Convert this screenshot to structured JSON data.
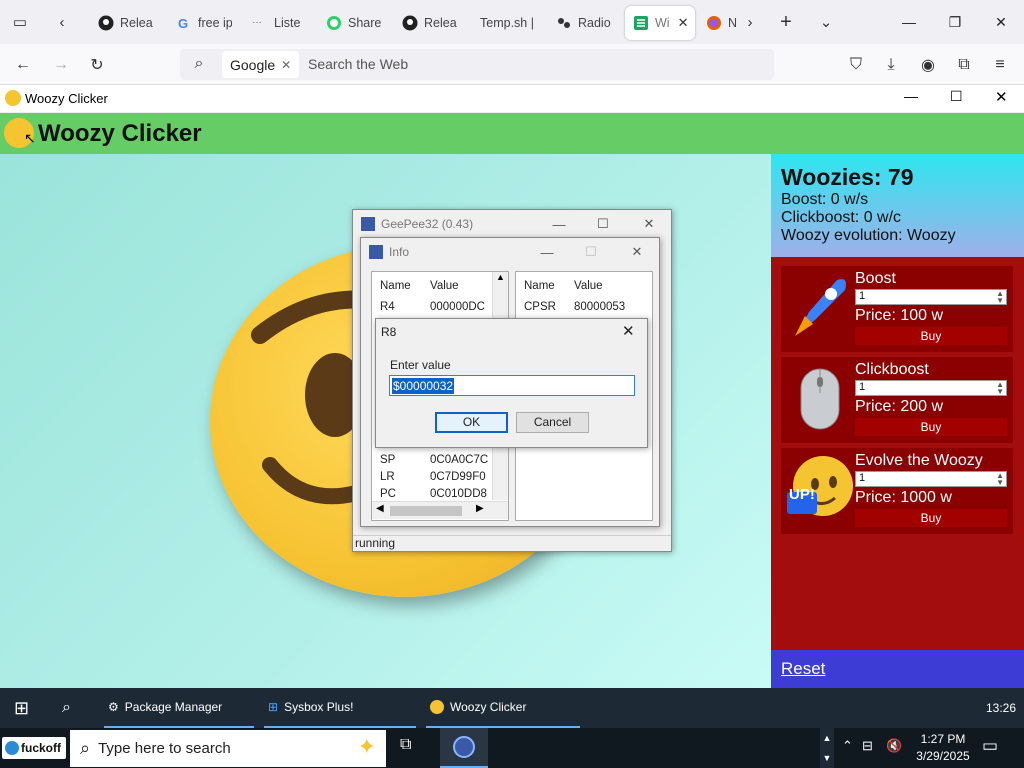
{
  "browser": {
    "tabs": [
      {
        "label": "Relea",
        "icon": "github-icon"
      },
      {
        "label": "free ip",
        "icon": "google-icon"
      },
      {
        "label": "Liste",
        "icon": "dots-icon"
      },
      {
        "label": "Share",
        "icon": "whatsapp-icon"
      },
      {
        "label": "Relea",
        "icon": "github-icon"
      },
      {
        "label": "Temp.sh |",
        "icon": "none"
      },
      {
        "label": "Radio",
        "icon": "radio-icon"
      },
      {
        "label": "Wi",
        "icon": "sheet-icon"
      },
      {
        "label": "N",
        "icon": "firefox-icon"
      }
    ],
    "search_engine_chip": "Google",
    "url_placeholder": "Search the Web"
  },
  "app": {
    "window_title": "Woozy Clicker",
    "header_title": "Woozy Clicker",
    "stats": {
      "woozies": "Woozies: 79",
      "boost": "Boost: 0 w/s",
      "clickboost": "Clickboost: 0 w/c",
      "evolution": "Woozy evolution: Woozy"
    },
    "shop": [
      {
        "title": "Boost",
        "qty": "1",
        "price": "Price: 100 w",
        "buy": "Buy",
        "icon": "rocket-icon"
      },
      {
        "title": "Clickboost",
        "qty": "1",
        "price": "Price: 200 w",
        "buy": "Buy",
        "icon": "mouse-icon"
      },
      {
        "title": "Evolve the Woozy",
        "qty": "1",
        "price": "Price: 1000 w",
        "buy": "Buy",
        "icon": "woozy-up-icon",
        "badge": "UP!"
      }
    ],
    "reset": "Reset"
  },
  "emulator": {
    "title": "GeePee32 (0.43)",
    "status": "running",
    "info_title": "Info",
    "col_name": "Name",
    "col_value": "Value",
    "left_regs": [
      {
        "name": "R4",
        "value": "000000DC"
      },
      {
        "name": "SP",
        "value": "0C0A0C7C"
      },
      {
        "name": "LR",
        "value": "0C7D99F0"
      },
      {
        "name": "PC",
        "value": "0C010DD8"
      }
    ],
    "right_regs": [
      {
        "name": "CPSR",
        "value": "80000053"
      }
    ]
  },
  "dialog": {
    "title": "R8",
    "label": "Enter value",
    "value": "$00000032",
    "ok": "OK",
    "cancel": "Cancel"
  },
  "taskbar_upper": {
    "items": [
      "Package Manager",
      "Sysbox Plus!",
      "Woozy Clicker"
    ],
    "clock": "13:26"
  },
  "taskbar": {
    "badge": "fuckoff",
    "search_placeholder": "Type here to search",
    "time": "1:27 PM",
    "date": "3/29/2025"
  }
}
